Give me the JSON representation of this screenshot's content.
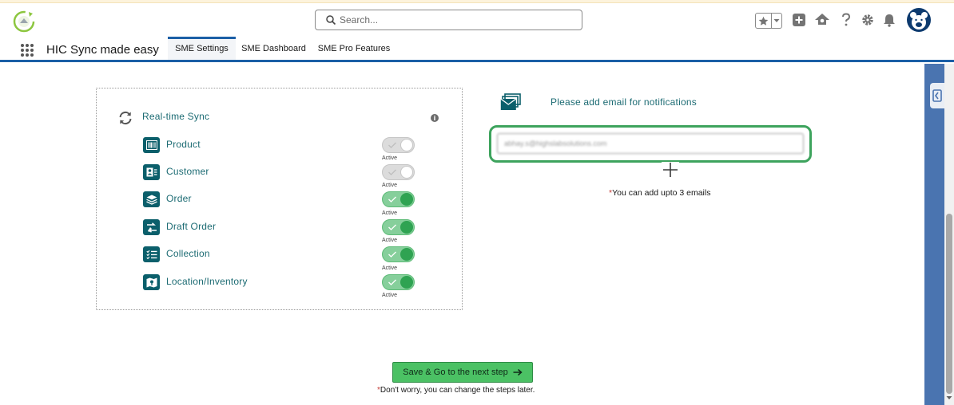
{
  "header": {
    "search_placeholder": "Search..."
  },
  "nav": {
    "app_name": "HIC Sync made easy",
    "tabs": [
      {
        "label": "SME Settings",
        "active": true
      },
      {
        "label": "SME Dashboard",
        "active": false
      },
      {
        "label": "SME Pro Features",
        "active": false
      }
    ]
  },
  "sync": {
    "title": "Real-time Sync",
    "info_glyph": "i",
    "items": [
      {
        "label": "Product",
        "icon": "barcode-icon",
        "enabled": false,
        "status": "Active"
      },
      {
        "label": "Customer",
        "icon": "customer-card-icon",
        "enabled": false,
        "status": "Active"
      },
      {
        "label": "Order",
        "icon": "layers-icon",
        "enabled": true,
        "status": "Active"
      },
      {
        "label": "Draft Order",
        "icon": "draft-order-icon",
        "enabled": true,
        "status": "Active"
      },
      {
        "label": "Collection",
        "icon": "checklist-icon",
        "enabled": true,
        "status": "Active"
      },
      {
        "label": "Location/Inventory",
        "icon": "map-icon",
        "enabled": true,
        "status": "Active"
      }
    ]
  },
  "email": {
    "heading": "Please add email for notifications",
    "value": "abhay.s@highslabsolutions.com",
    "note_mark": "*",
    "note": "You can add upto 3 emails"
  },
  "footer": {
    "save_label": "Save & Go to the next step",
    "note_mark": "*",
    "note": "Don't worry, you can change the steps later."
  },
  "colors": {
    "accent": "#1b5fa6",
    "teal_text": "#1c6b73",
    "icon_bg": "#0b5f6b",
    "toggle_on": "#2fa352",
    "highlight": "#3da35d",
    "save_button": "#4bc164"
  }
}
